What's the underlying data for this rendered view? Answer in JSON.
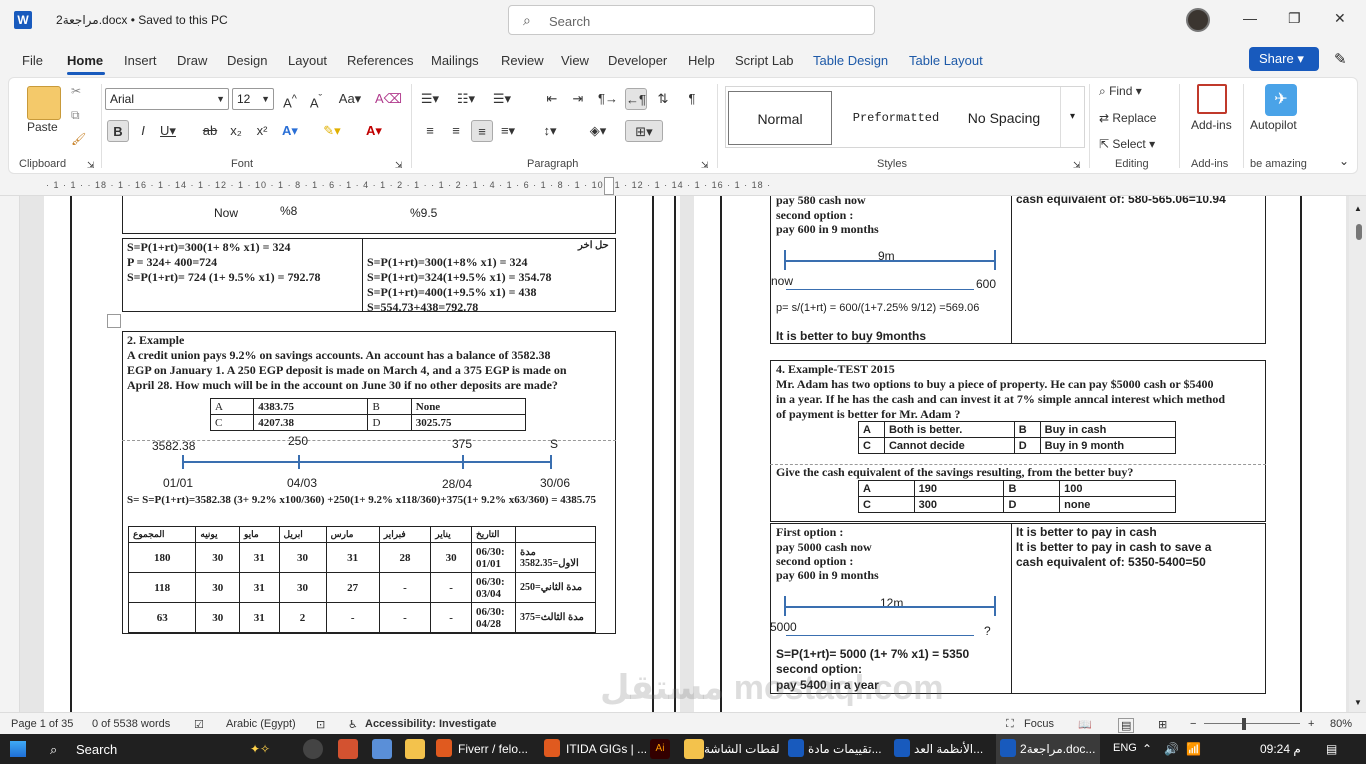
{
  "window": {
    "title": "مراجعة2.docx • Saved to this PC",
    "search_placeholder": "Search"
  },
  "menu": [
    "File",
    "Home",
    "Insert",
    "Draw",
    "Design",
    "Layout",
    "References",
    "Mailings",
    "Review",
    "View",
    "Developer",
    "Help",
    "Script Lab",
    "Table Design",
    "Table Layout"
  ],
  "share_label": "Share",
  "ribbon": {
    "clipboard": "Clipboard",
    "paste": "Paste",
    "font_group": "Font",
    "paragraph_group": "Paragraph",
    "styles_group": "Styles",
    "editing_group": "Editing",
    "addins_group": "Add-ins",
    "amazing": "be amazing",
    "font_name": "Arial",
    "font_size": "12",
    "styles": [
      "Normal",
      "Preformatted",
      "No Spacing"
    ],
    "find": "Find",
    "replace": "Replace",
    "select": "Select",
    "addins": "Add-ins",
    "autopilot": "Autopilot"
  },
  "ruler": "· 1 · 1 · · 18 · 1 · 16 · 1 · 14 · 1 · 12 · 1 · 10 · 1 · 8 · 1 · 6 · 1 · 4 · 1 · 2 · 1 ·   · 1 · 2 · 1 · 4 · 1 · 6 · 1 · 8 · 1 · 10 · 1 · 12 · 1 · 14 · 1 · 16 · 1 · 18 ·",
  "left_page": {
    "now": "Now",
    "p8": "%8",
    "p95": "%9.5",
    "l1": "S=P(1+rt)=300(1+ 8% x1) = 324",
    "l2": "P = 324+ 400=724",
    "l3": "S=P(1+rt)= 724 (1+ 9.5% x1) = 792.78",
    "other": "حل اخر",
    "r1": "S=P(1+rt)=300(1+8% x1) = 324",
    "r2": "S=P(1+rt)=324(1+9.5% x1) = 354.78",
    "r3": "S=P(1+rt)=400(1+9.5% x1) = 438",
    "r4": "S=554.73+438=792.78",
    "ex_title": "2. Example",
    "ex_text1": "A credit union pays 9.2% on savings accounts. An account has a balance of 3582.38",
    "ex_text2": "EGP on January 1. A 250 EGP deposit is made on March 4, and a 375 EGP is made on",
    "ex_text3": "April 28. How much will be in the account on June 30 if no other deposits are made?",
    "opts": [
      [
        "A",
        "4383.75",
        "B",
        "None"
      ],
      [
        "C",
        "4207.38",
        "D",
        "3025.75"
      ]
    ],
    "tl_top": [
      "3582.38",
      "250",
      "375",
      "S"
    ],
    "tl_bot": [
      "01/01",
      "04/03",
      "28/04",
      "30/06"
    ],
    "formula": "S= S=P(1+rt)=3582.38 (3+ 9.2% x100/360) +250(1+ 9.2% x118/360)+375(1+ 9.2% x63/360) = 4385.75",
    "table_head": [
      "المجموع",
      "يونيه",
      "مايو",
      "ابريل",
      "مارس",
      "فبراير",
      "يناير",
      "التاريخ",
      ""
    ],
    "table_rows": [
      [
        "180",
        "30",
        "31",
        "30",
        "31",
        "28",
        "30",
        "06/30: 01/01",
        "مدة الاول=3582.35"
      ],
      [
        "118",
        "30",
        "31",
        "30",
        "27",
        "-",
        "-",
        "06/30: 03/04",
        "مدة الثاني=250"
      ],
      [
        "63",
        "30",
        "31",
        "2",
        "-",
        "-",
        "-",
        "06/30: 04/28",
        "مدة الثالث=375"
      ]
    ]
  },
  "right_page": {
    "a1": "pay 580 cash now",
    "a2": "second option :",
    "a3": "pay 600 in 9 months",
    "a_right": "cash equivalent of: 580-565.06=10.94",
    "tl1_top": "9m",
    "tl1_now": "now",
    "tl1_600": "600",
    "pv": "p= s/(1+rt) = 600/(1+7.25% 9/12) =569.06",
    "better": "It is better to buy 9months",
    "ex4_title": "4. Example-TEST 2015",
    "ex4_1": "Mr. Adam has two options to buy a piece of property. He can pay $5000 cash or $5400",
    "ex4_2": "in a year. If he has the cash and can invest it at 7% simple anncal interest which method",
    "ex4_3": "of payment is better for Mr. Adam ?",
    "opts1": [
      [
        "A",
        "Both is better.",
        "B",
        "Buy in cash"
      ],
      [
        "C",
        "Cannot decide",
        "D",
        "Buy in 9 month"
      ]
    ],
    "q2": "Give the cash equivalent of the savings resulting, from the better buy?",
    "opts2": [
      [
        "A",
        "190",
        "B",
        "100"
      ],
      [
        "C",
        "300",
        "D",
        "none"
      ]
    ],
    "b1": "First option :",
    "b2": "pay 5000 cash now",
    "b3": "second option :",
    "b4": "pay 600 in 9 months",
    "b_r1": "It is better to pay in cash",
    "b_r2": "It is better to pay in cash to save a",
    "b_r3": "cash equivalent of: 5350-5400=50",
    "tl2_top": "12m",
    "tl2_5000": "5000",
    "tl2_q": "?",
    "c1": "S=P(1+rt)= 5000 (1+ 7% x1) = 5350",
    "c2": "second option:",
    "c3": "pay 5400 in a year"
  },
  "status": {
    "page": "Page 1 of 35",
    "words": "0 of 5538 words",
    "lang": "Arabic (Egypt)",
    "access": "Accessibility: Investigate",
    "focus": "Focus",
    "zoom": "80%"
  },
  "taskbar": {
    "search": "Search",
    "fiverr": "Fiverr / felo...",
    "itida": "ITIDA GIGs | ...",
    "shots": "لقطات الشاشة",
    "w1": "تقييمات مادة...",
    "w2": "الأنظمة العد...",
    "w3": "مراجعة2.doc...",
    "lang": "ENG",
    "time": "09:24 م"
  },
  "watermark": "مستقل mostaql.com"
}
